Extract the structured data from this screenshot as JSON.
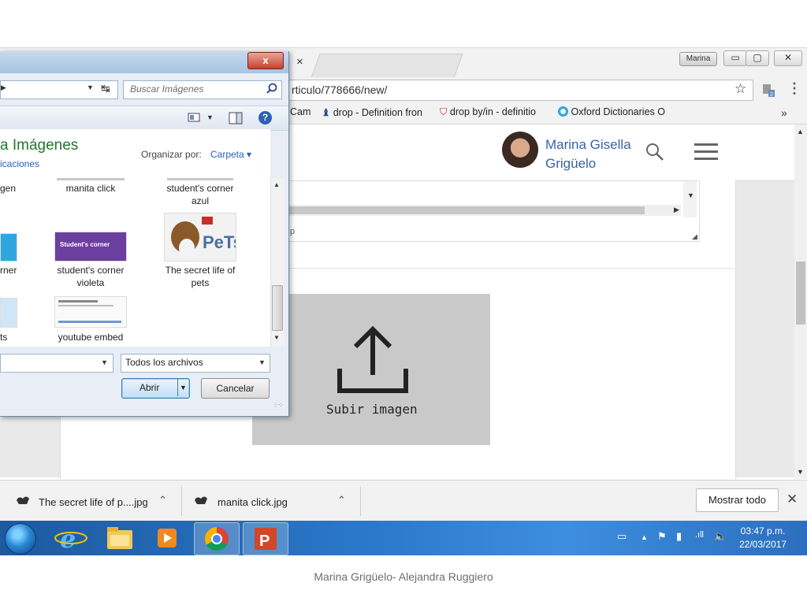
{
  "browser": {
    "tab_close": "×",
    "user_chip": "Marina",
    "window_buttons": [
      "▭",
      "▢",
      "✕"
    ],
    "url": "rticulo/778666/new/",
    "bookmarks": [
      {
        "label": "Cam",
        "icon": "bookmark-icon"
      },
      {
        "label": "drop - Definition fron",
        "icon": "dictionary-icon"
      },
      {
        "label": "drop by/in - definitio",
        "icon": "shield-icon"
      },
      {
        "label": "Oxford Dictionaries O",
        "icon": "oxford-icon"
      }
    ],
    "bookmarks_more": "»"
  },
  "page": {
    "user_name_line1": "Marina Gisella",
    "user_name_line2": "Grigüelo",
    "editor_p": "p",
    "upload_label": "Subir imagen"
  },
  "dialog": {
    "close": "x",
    "search_placeholder": "Buscar Imágenes",
    "library_title": "a Imágenes",
    "library_subtitle": "icaciones",
    "arrange_label": "Organizar por:",
    "arrange_value": "Carpeta ▾",
    "help": "?",
    "files_row1": [
      "gen",
      "manita click",
      "student's corner azul"
    ],
    "files_row2": [
      "rner",
      "student's corner violeta",
      "The secret life of pets"
    ],
    "files_row3": [
      "ts",
      "youtube embed"
    ],
    "thumb_texts": {
      "student_corner": "Student's corner",
      "pets": "PeTs"
    },
    "filetype": "Todos los archivos",
    "open": "Abrir",
    "cancel": "Cancelar"
  },
  "downloads": {
    "items": [
      {
        "label": "The secret life of p....jpg"
      },
      {
        "label": "manita click.jpg"
      }
    ],
    "show_all": "Mostrar todo",
    "close": "✕"
  },
  "taskbar": {
    "time": "03:47 p.m.",
    "date": "22/03/2017"
  },
  "footer": {
    "caption": "Marina Grigüelo- Alejandra Ruggiero"
  },
  "colors": {
    "name_link": "#3a62a7",
    "library_title": "#1e7a2c",
    "taskbar": "#2b77c9",
    "upload_box": "#c9c9c9"
  }
}
